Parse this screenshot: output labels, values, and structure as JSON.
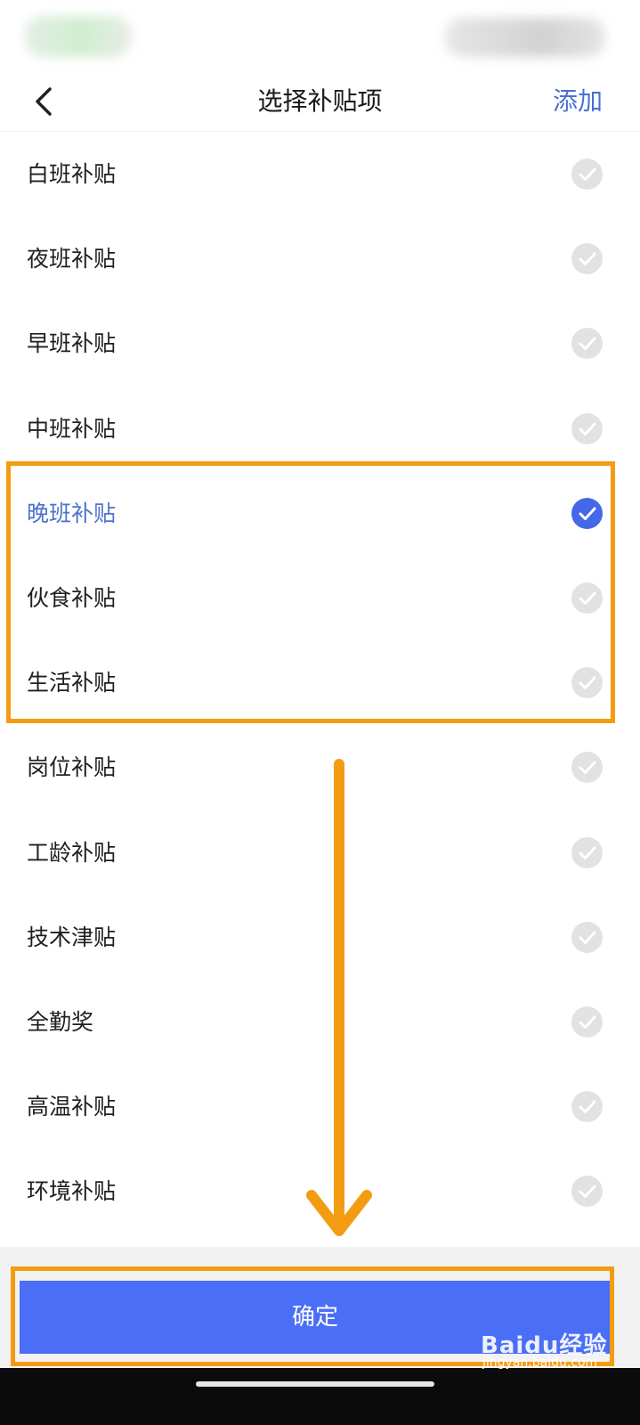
{
  "header": {
    "title": "选择补贴项",
    "add_label": "添加"
  },
  "subsidies": [
    {
      "label": "白班补贴",
      "selected": false
    },
    {
      "label": "夜班补贴",
      "selected": false
    },
    {
      "label": "早班补贴",
      "selected": false
    },
    {
      "label": "中班补贴",
      "selected": false
    },
    {
      "label": "晚班补贴",
      "selected": true
    },
    {
      "label": "伙食补贴",
      "selected": false
    },
    {
      "label": "生活补贴",
      "selected": false
    },
    {
      "label": "岗位补贴",
      "selected": false
    },
    {
      "label": "工龄补贴",
      "selected": false
    },
    {
      "label": "技术津贴",
      "selected": false
    },
    {
      "label": "全勤奖",
      "selected": false
    },
    {
      "label": "高温补贴",
      "selected": false
    },
    {
      "label": "环境补贴",
      "selected": false
    }
  ],
  "confirm_label": "确定",
  "watermark": {
    "logo": "Baidu经验",
    "url": "jingyan.baidu.com"
  },
  "colors": {
    "accent": "#4a6ef5",
    "selected_text": "#4c72cc",
    "highlight": "#f39c12"
  },
  "icons": {
    "back": "chevron-left-icon",
    "check": "check-circle-icon"
  }
}
